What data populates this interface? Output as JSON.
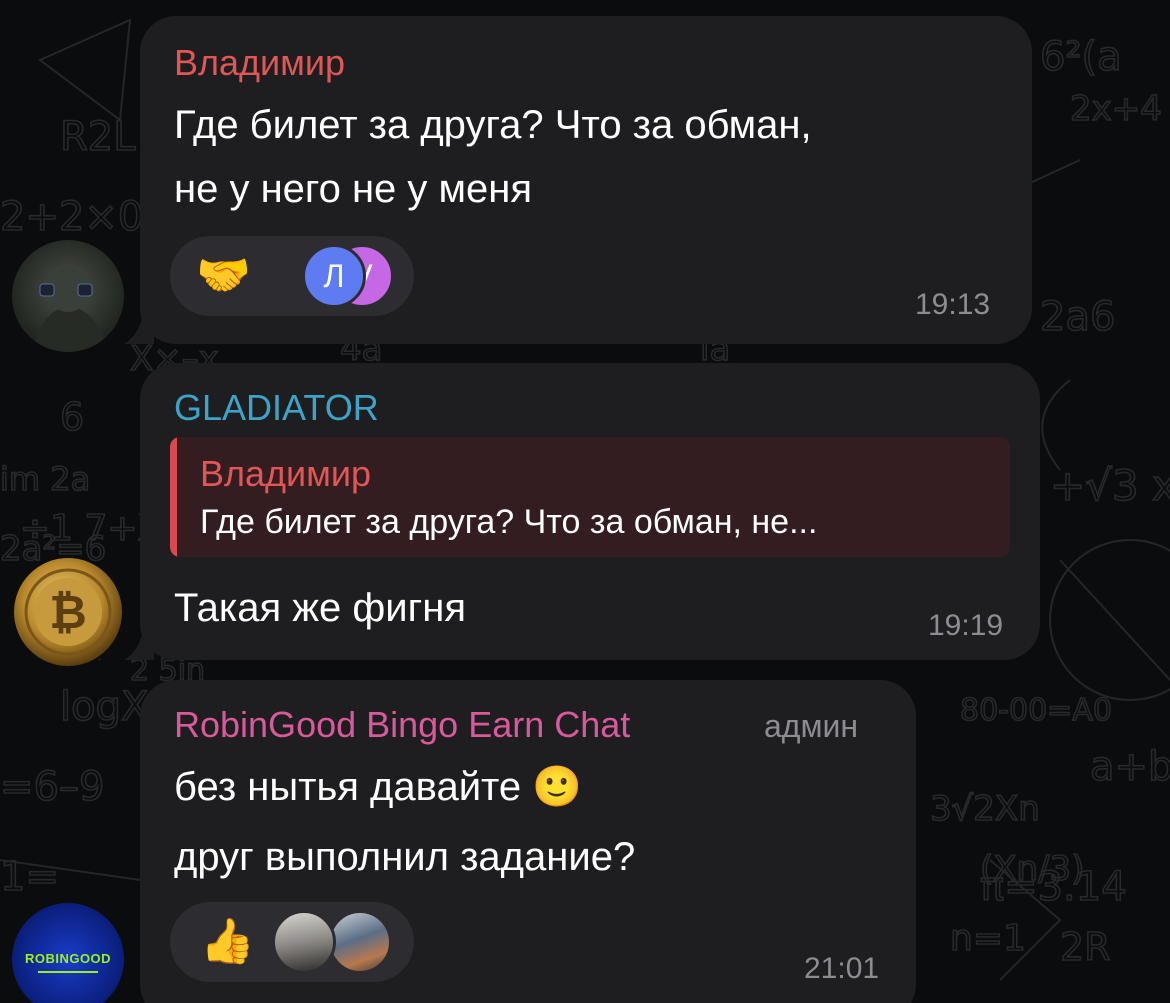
{
  "messages": [
    {
      "sender": "Владимир",
      "sender_color": "#e05756",
      "lines": [
        "Где билет за друга? Что за обман,",
        "не у него не у меня"
      ],
      "time": "19:13",
      "reaction": {
        "emoji": "🤝",
        "icon": "handshake-icon",
        "reactors": [
          "Л",
          "V"
        ],
        "reactor_colors": [
          "#5f7bf2",
          "#c667e6"
        ]
      }
    },
    {
      "sender": "GLADIATOR",
      "sender_color": "#3ea3c8",
      "reply": {
        "sender": "Владимир",
        "sender_color": "#e05756",
        "text": "Где билет за друга? Что за обман, не..."
      },
      "lines": [
        "Такая же фигня"
      ],
      "time": "19:19"
    },
    {
      "sender": "RobinGood Bingo Earn Chat",
      "sender_color": "#d85a9c",
      "role": "админ",
      "lines": [
        "без нытья давайте 🙂",
        "друг выполнил задание?"
      ],
      "time": "21:01",
      "reaction": {
        "emoji": "👍",
        "icon": "thumbs-up-icon"
      }
    }
  ],
  "avatars": {
    "robingood_label": "ROBINGOOD"
  },
  "colors": {
    "background": "#0b0c0d",
    "bubble": "#1e1e21",
    "time": "#8c8c92",
    "reaction_pill": "#2d2d31"
  }
}
